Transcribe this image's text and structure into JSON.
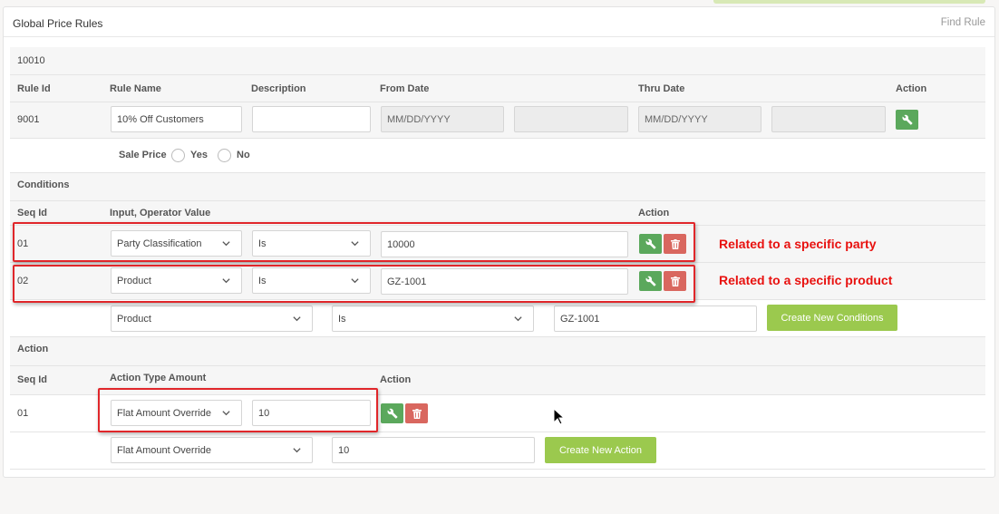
{
  "header": {
    "title": "Global Price Rules",
    "find_rule_link": "Find Rule"
  },
  "rule": {
    "record_id": "10010",
    "columns": {
      "rule_id": "Rule Id",
      "rule_name": "Rule Name",
      "description": "Description",
      "from_date": "From Date",
      "thru_date": "Thru Date",
      "action": "Action"
    },
    "rule_id_value": "9001",
    "rule_name_value": "10% Off Customers",
    "description_value": "",
    "from_date_placeholder": "MM/DD/YYYY",
    "thru_date_placeholder": "MM/DD/YYYY",
    "sale_price_label": "Sale Price",
    "yes_label": "Yes",
    "no_label": "No"
  },
  "conditions": {
    "section_title": "Conditions",
    "columns": {
      "seq_id": "Seq Id",
      "input_operator_value": "Input, Operator Value",
      "action": "Action"
    },
    "rows": [
      {
        "seq": "01",
        "input": "Party Classification",
        "operator": "Is",
        "value": "10000"
      },
      {
        "seq": "02",
        "input": "Product",
        "operator": "Is",
        "value": "GZ-1001"
      }
    ],
    "new": {
      "input": "Product",
      "operator": "Is",
      "value": "GZ-1001",
      "button": "Create New Conditions"
    }
  },
  "actions": {
    "section_title": "Action",
    "columns": {
      "seq_id": "Seq Id",
      "action_type_amount": "Action Type Amount",
      "action": "Action"
    },
    "rows": [
      {
        "seq": "01",
        "type": "Flat Amount Override",
        "amount": "10"
      }
    ],
    "new": {
      "type": "Flat Amount Override",
      "amount": "10",
      "button": "Create New Action"
    }
  },
  "annotations": {
    "party": "Related to a specific party",
    "product": "Related to a specific product"
  },
  "colors": {
    "accent_green": "#5ba85c",
    "delete_red": "#d9675f",
    "create_lime": "#9bc94e",
    "highlight_red": "#e0262a"
  }
}
